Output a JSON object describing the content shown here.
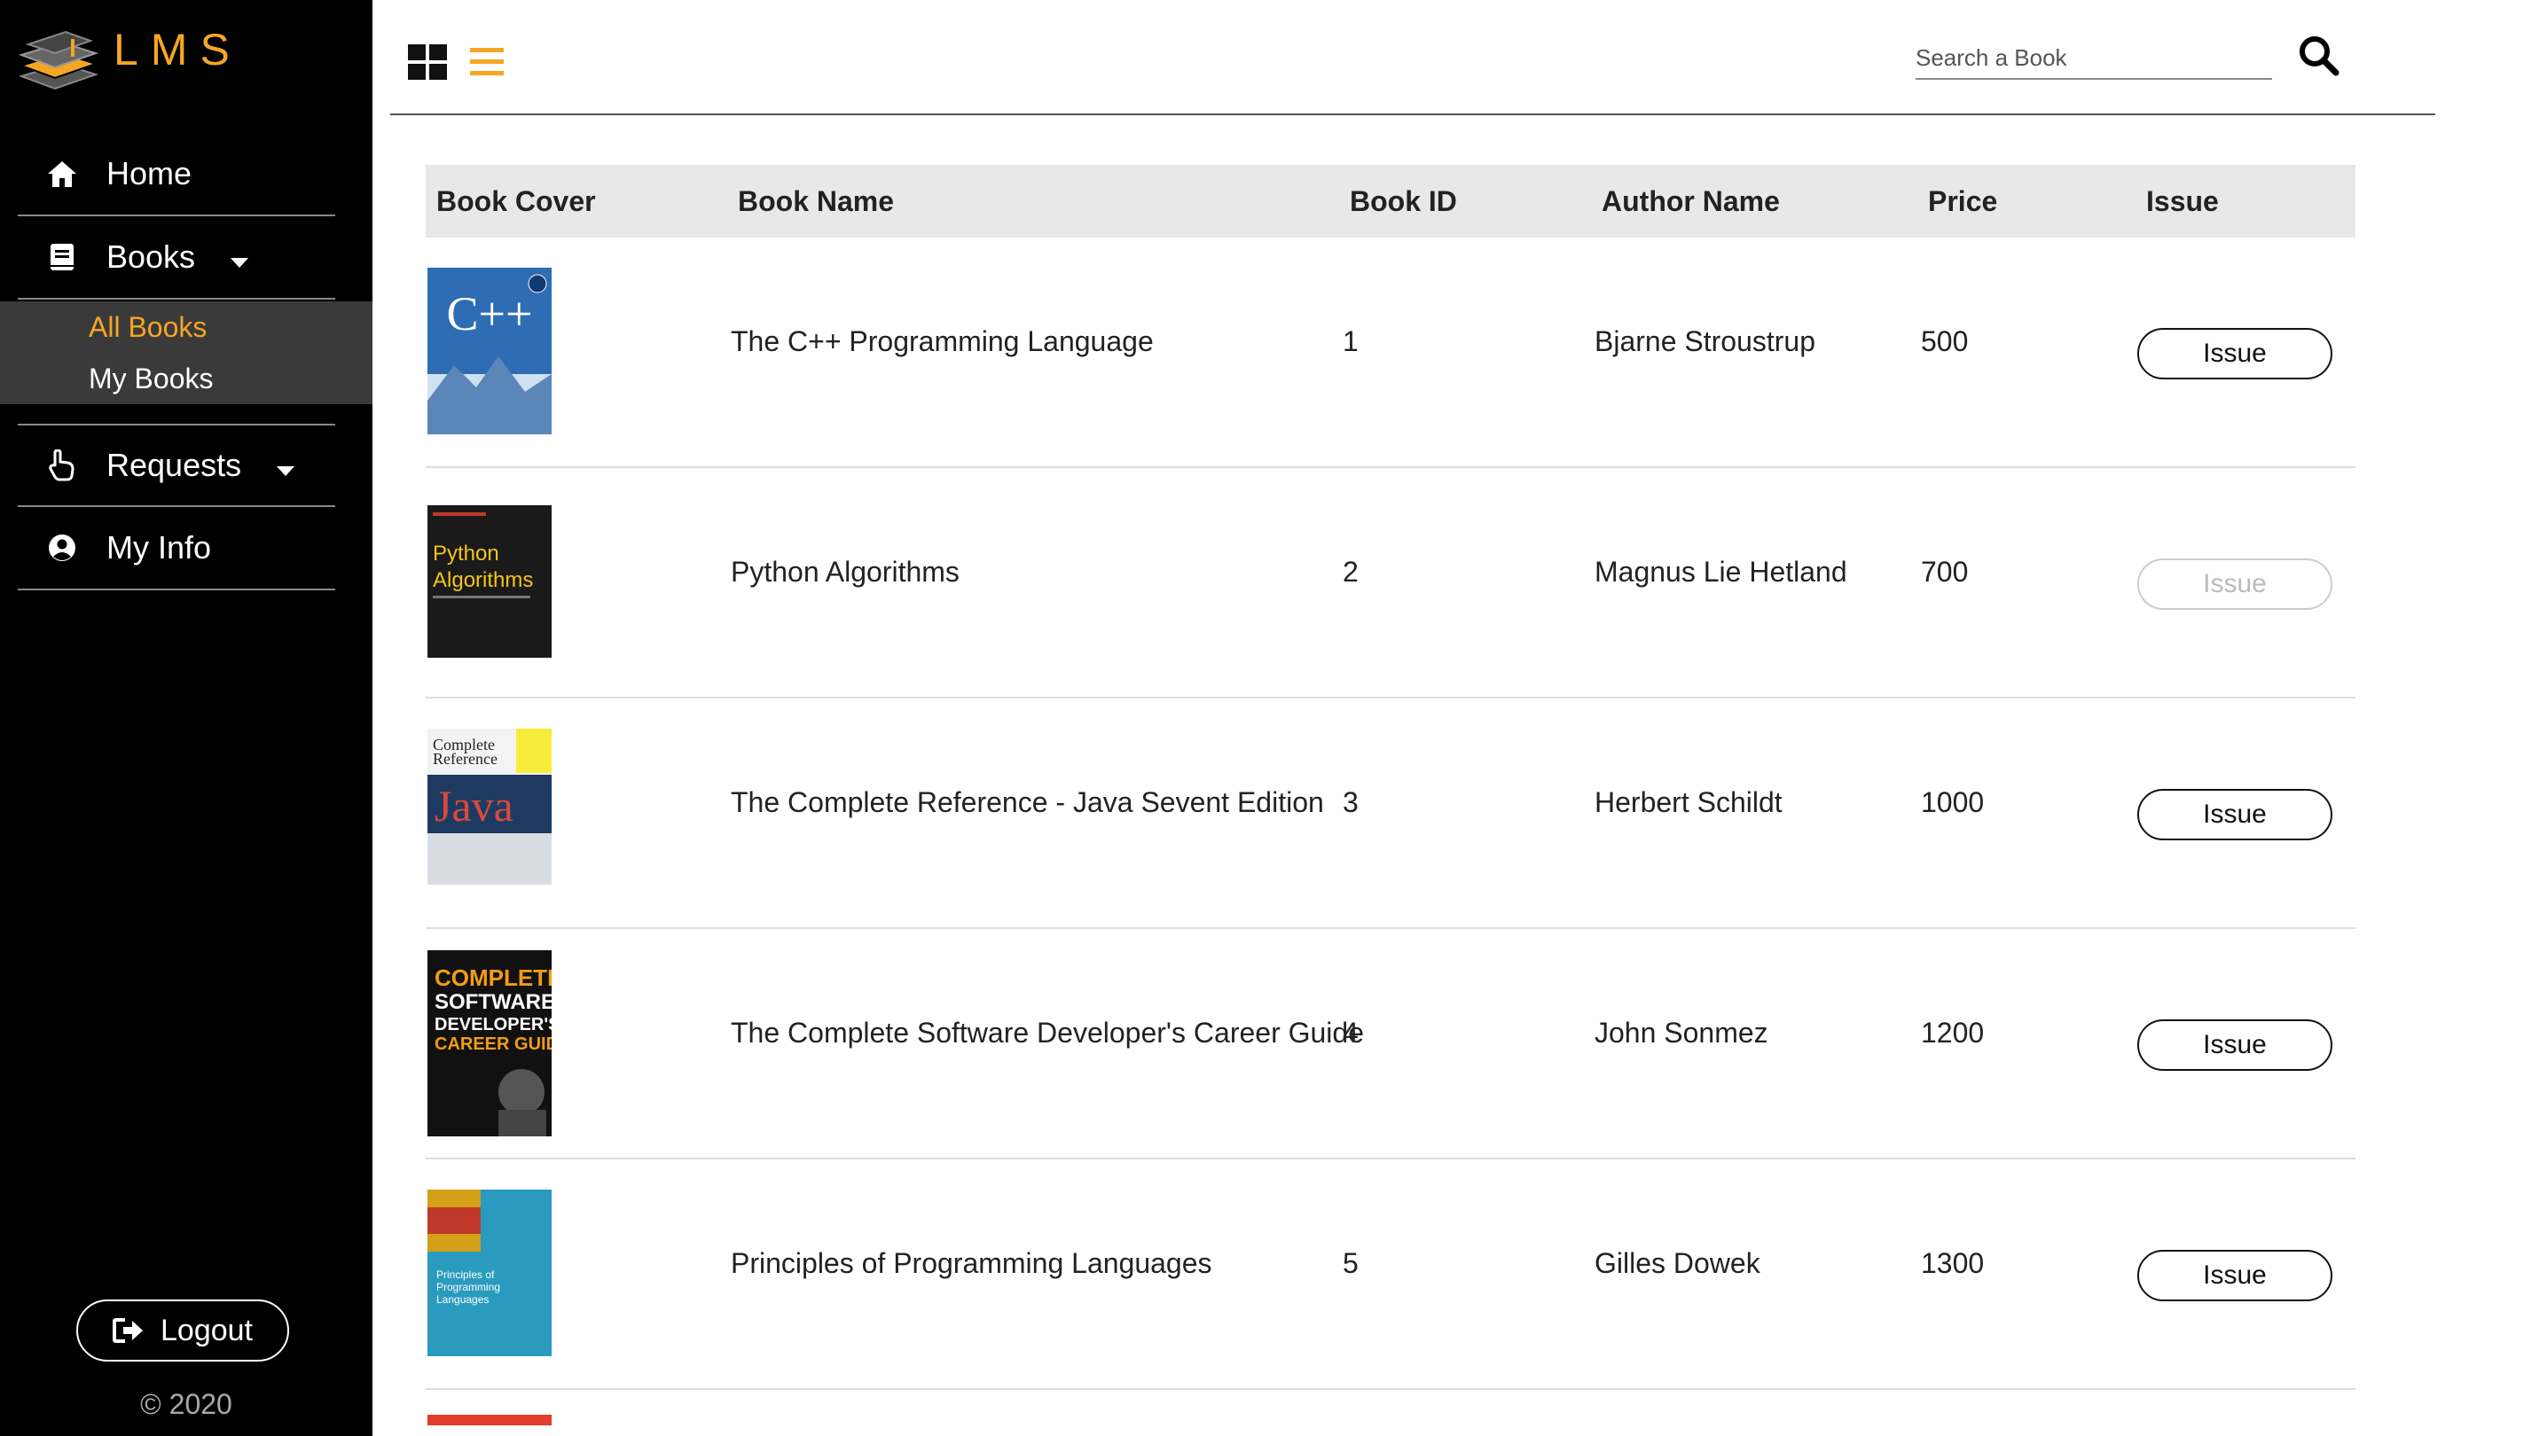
{
  "app": {
    "logo_text": "LMS"
  },
  "sidebar": {
    "nav": [
      {
        "label": "Home",
        "icon": "home-icon"
      },
      {
        "label": "Books",
        "icon": "book-icon",
        "has_caret": true
      },
      {
        "label": "Requests",
        "icon": "hand-pointer-icon",
        "has_caret": true
      },
      {
        "label": "My Info",
        "icon": "user-circle-icon"
      }
    ],
    "books_submenu": [
      {
        "label": "All Books",
        "active": true
      },
      {
        "label": "My Books",
        "active": false
      }
    ],
    "logout_label": "Logout",
    "copyright": "© 2020"
  },
  "topbar": {
    "search_placeholder": "Search a Book"
  },
  "table": {
    "headers": [
      "Book Cover",
      "Book Name",
      "Book ID",
      "Author Name",
      "Price",
      "Issue"
    ],
    "rows": [
      {
        "name": "The C++ Programming Language",
        "id": "1",
        "author": "Bjarne Stroustrup",
        "price": "500",
        "issue_label": "Issue",
        "issue_enabled": true,
        "cover": {
          "bg": "#2e6db4",
          "accent": "#ffffff",
          "label": "C++"
        }
      },
      {
        "name": "Python Algorithms",
        "id": "2",
        "author": "Magnus Lie Hetland",
        "price": "700",
        "issue_label": "Issue",
        "issue_enabled": false,
        "cover": {
          "bg": "#1a1a1a",
          "accent": "#f5c518",
          "label": "Python Algorithms"
        }
      },
      {
        "name": "The Complete Reference - Java Sevent Edition",
        "id": "3",
        "author": "Herbert Schildt",
        "price": "1000",
        "issue_label": "Issue",
        "issue_enabled": true,
        "cover": {
          "bg": "#f3f3f3",
          "accent": "#c0392b",
          "label": "Java"
        }
      },
      {
        "name": "The Complete Software Developer's Career Guide",
        "id": "4",
        "author": "John Sonmez",
        "price": "1200",
        "issue_label": "Issue",
        "issue_enabled": true,
        "cover": {
          "bg": "#111111",
          "accent": "#f39c12",
          "label": "COMPLETE SOFTWARE DEVELOPER'S CAREER GUIDE"
        }
      },
      {
        "name": "Principles of Programming Languages",
        "id": "5",
        "author": "Gilles Dowek",
        "price": "1300",
        "issue_label": "Issue",
        "issue_enabled": true,
        "cover": {
          "bg": "#2a9bbf",
          "accent": "#f1c40f",
          "label": "Principles of Programming Languages"
        }
      }
    ]
  },
  "colors": {
    "accent": "#f5a623",
    "sidebar_bg": "#000000",
    "submenu_bg": "#3a3a3a",
    "header_bg": "#e8e8e8"
  }
}
